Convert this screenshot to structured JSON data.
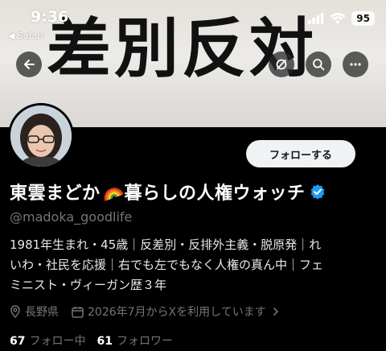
{
  "status_bar": {
    "time": "9:36",
    "back_app": "◀ Safari",
    "battery": "95"
  },
  "banner": {
    "text": "差別反対"
  },
  "profile": {
    "follow_label": "フォローする",
    "name_part1": "東雲まどか",
    "name_part2": "暮らしの人権ウォッチ",
    "handle": "@madoka_goodlife",
    "bio_lines": [
      "1981年生まれ・45歳｜反差別・反排外主義・脱原発｜れ",
      "いわ・社民を応援｜右でも左でもなく人権の真ん中｜フェ",
      "ミニスト・ヴィーガン歴３年"
    ],
    "location": "長野県",
    "joined": "2026年7月からXを利用しています",
    "following_count": "67",
    "following_label": "フォロー中",
    "followers_count": "61",
    "followers_label": "フォロワー"
  },
  "icons": [
    "back-arrow-icon",
    "refresh-icon",
    "search-icon",
    "more-icon",
    "location-pin-icon",
    "calendar-icon",
    "chevron-right-icon",
    "verified-badge-icon",
    "rainbow-emoji-icon"
  ],
  "colors": {
    "verified": "#1d9bf0",
    "follow_button_bg": "#eff3f4",
    "muted_text": "#71767b"
  }
}
